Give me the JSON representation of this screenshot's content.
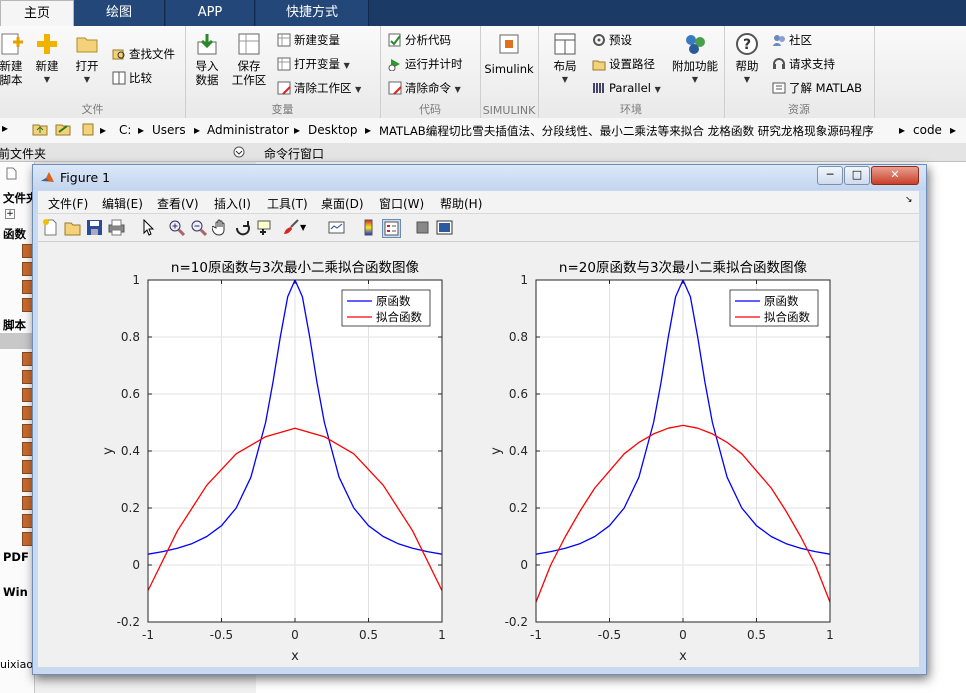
{
  "tabs": [
    "主页",
    "绘图",
    "APP",
    "快捷方式"
  ],
  "ribbon": {
    "file": {
      "title": "文件",
      "new_script": "新建\n脚本",
      "new": "新建",
      "open": "打开",
      "find_files": "查找文件",
      "compare": "比较"
    },
    "variable": {
      "title": "变量",
      "import": "导入\n数据",
      "save_ws": "保存\n工作区",
      "new_var": "新建变量",
      "open_var": "打开变量",
      "clear_ws": "清除工作区"
    },
    "code": {
      "title": "代码",
      "analyze": "分析代码",
      "run_time": "运行并计时",
      "clear_cmd": "清除命令"
    },
    "simulink": {
      "title": "SIMULINK",
      "label": "Simulink"
    },
    "env": {
      "title": "环境",
      "layout": "布局",
      "prefs": "预设",
      "set_path": "设置路径",
      "parallel": "Parallel",
      "addons": "附加功能"
    },
    "resources": {
      "title": "资源",
      "help": "帮助",
      "community": "社区",
      "support": "请求支持",
      "learn": "了解 MATLAB"
    }
  },
  "address": [
    "C:",
    "Users",
    "Administrator",
    "Desktop",
    "MATLAB编程切比雪夫插值法、分段线性、最小二乘法等来拟合 龙格函数 研究龙格现象源码程序",
    "code"
  ],
  "panes": {
    "current_folder": "当前文件夹",
    "command_window": "命令行窗口"
  },
  "left_labels": [
    "文件夹",
    "函数",
    "脚本",
    "PDF",
    "Win",
    "uixiao"
  ],
  "figure": {
    "title": "Figure 1",
    "menu": [
      "文件(F)",
      "编辑(E)",
      "查看(V)",
      "插入(I)",
      "工具(T)",
      "桌面(D)",
      "窗口(W)",
      "帮助(H)"
    ],
    "icons": [
      "new-figure-icon",
      "open-icon",
      "save-icon",
      "print-icon",
      "pointer-icon",
      "zoom-in-icon",
      "zoom-out-icon",
      "pan-icon",
      "rotate-icon",
      "data-cursor-icon",
      "brush-icon",
      "link-icon",
      "colorbar-icon",
      "legend-icon",
      "hide-plot-tools-icon",
      "show-plot-tools-icon"
    ]
  },
  "chart_data": [
    {
      "type": "line",
      "title": "n=10原函数与3次最小二乘拟合函数图像",
      "xlabel": "x",
      "ylabel": "y",
      "xlim": [
        -1,
        1
      ],
      "ylim": [
        -0.2,
        1
      ],
      "xticks": [
        "-1",
        "-0.5",
        "0",
        "0.5",
        "1"
      ],
      "yticks": [
        "-0.2",
        "0",
        "0.2",
        "0.4",
        "0.6",
        "0.8",
        "1"
      ],
      "grid": true,
      "legend_position": "top-right",
      "series": [
        {
          "name": "原函数",
          "color": "#0000ff",
          "x": [
            -1,
            -0.9,
            -0.8,
            -0.7,
            -0.6,
            -0.5,
            -0.4,
            -0.3,
            -0.2,
            -0.15,
            -0.1,
            -0.05,
            0,
            0.05,
            0.1,
            0.15,
            0.2,
            0.3,
            0.4,
            0.5,
            0.6,
            0.7,
            0.8,
            0.9,
            1
          ],
          "y": [
            0.038,
            0.047,
            0.059,
            0.075,
            0.1,
            0.138,
            0.2,
            0.308,
            0.5,
            0.64,
            0.8,
            0.941,
            1,
            0.941,
            0.8,
            0.64,
            0.5,
            0.308,
            0.2,
            0.138,
            0.1,
            0.075,
            0.059,
            0.047,
            0.038
          ]
        },
        {
          "name": "拟合函数",
          "color": "#ff0000",
          "x": [
            -1,
            -0.8,
            -0.6,
            -0.4,
            -0.2,
            0,
            0.2,
            0.4,
            0.6,
            0.8,
            1
          ],
          "y": [
            -0.09,
            0.12,
            0.28,
            0.39,
            0.45,
            0.48,
            0.45,
            0.39,
            0.28,
            0.12,
            -0.09
          ]
        }
      ]
    },
    {
      "type": "line",
      "title": "n=20原函数与3次最小二乘拟合函数图像",
      "xlabel": "x",
      "ylabel": "y",
      "xlim": [
        -1,
        1
      ],
      "ylim": [
        -0.2,
        1
      ],
      "xticks": [
        "-1",
        "-0.5",
        "0",
        "0.5",
        "1"
      ],
      "yticks": [
        "-0.2",
        "0",
        "0.2",
        "0.4",
        "0.6",
        "0.8",
        "1"
      ],
      "grid": true,
      "legend_position": "top-right",
      "series": [
        {
          "name": "原函数",
          "color": "#0000ff",
          "x": [
            -1,
            -0.9,
            -0.8,
            -0.7,
            -0.6,
            -0.5,
            -0.4,
            -0.3,
            -0.2,
            -0.15,
            -0.1,
            -0.05,
            0,
            0.05,
            0.1,
            0.15,
            0.2,
            0.3,
            0.4,
            0.5,
            0.6,
            0.7,
            0.8,
            0.9,
            1
          ],
          "y": [
            0.038,
            0.047,
            0.059,
            0.075,
            0.1,
            0.138,
            0.2,
            0.308,
            0.5,
            0.64,
            0.8,
            0.941,
            1,
            0.941,
            0.8,
            0.64,
            0.5,
            0.308,
            0.2,
            0.138,
            0.1,
            0.075,
            0.059,
            0.047,
            0.038
          ]
        },
        {
          "name": "拟合函数",
          "color": "#ff0000",
          "x": [
            -1,
            -0.9,
            -0.8,
            -0.7,
            -0.6,
            -0.5,
            -0.4,
            -0.3,
            -0.2,
            -0.1,
            0,
            0.1,
            0.2,
            0.3,
            0.4,
            0.5,
            0.6,
            0.7,
            0.8,
            0.9,
            1
          ],
          "y": [
            -0.13,
            0.0,
            0.1,
            0.19,
            0.27,
            0.33,
            0.39,
            0.43,
            0.46,
            0.48,
            0.49,
            0.48,
            0.46,
            0.43,
            0.39,
            0.33,
            0.27,
            0.19,
            0.1,
            0.0,
            -0.13
          ]
        }
      ]
    }
  ]
}
